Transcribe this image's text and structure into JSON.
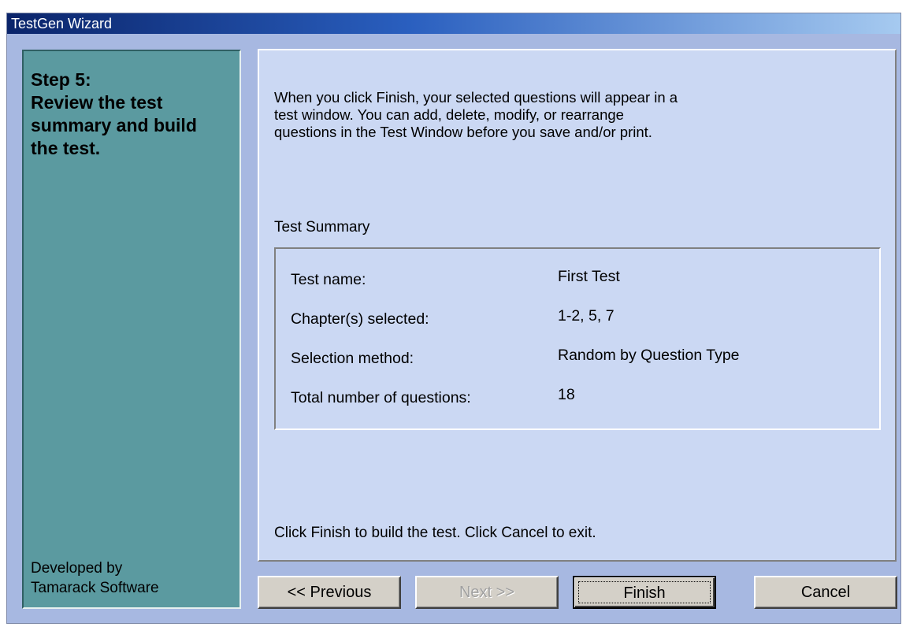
{
  "window": {
    "title": "TestGen Wizard"
  },
  "sidebar": {
    "step_title_lines": [
      "Step 5:",
      "Review the test",
      "summary and build",
      "the test."
    ],
    "developer_lines": [
      "Developed by",
      "Tamarack Software"
    ]
  },
  "main": {
    "intro_lines": [
      "When you click Finish, your selected questions will appear in a",
      "test window. You can add, delete, modify, or rearrange",
      "questions in the Test Window before you save and/or print."
    ],
    "summary_heading": "Test Summary",
    "summary_rows": [
      {
        "label": "Test name:",
        "value": "First Test"
      },
      {
        "label": "Chapter(s) selected:",
        "value": "1-2, 5, 7"
      },
      {
        "label": "Selection method:",
        "value": "Random by Question Type"
      },
      {
        "label": "Total number of questions:",
        "value": "18"
      }
    ],
    "footer": "Click Finish to build the test. Click Cancel to exit."
  },
  "buttons": {
    "previous": "<< Previous",
    "next": "Next >>",
    "finish": "Finish",
    "cancel": "Cancel"
  },
  "colors": {
    "sidebar_bg": "#5b9aa0",
    "content_bg": "#cbd8f3",
    "window_bg": "#a7b8e1",
    "titlebar_start": "#0a246a"
  }
}
